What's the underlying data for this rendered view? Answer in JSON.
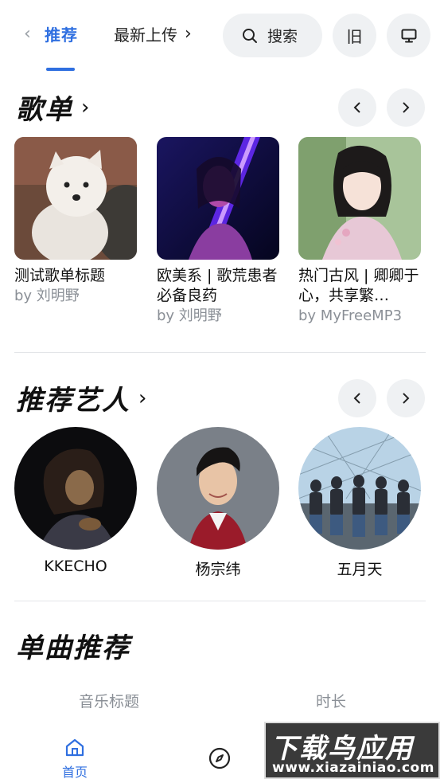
{
  "header": {
    "tabs": [
      {
        "label": "推荐",
        "active": true
      },
      {
        "label": "最新上传",
        "active": false
      }
    ],
    "search_label": "搜索",
    "old_label": "旧"
  },
  "playlists": {
    "title": "歌单",
    "items": [
      {
        "title": "测试歌单标题",
        "by": "by 刘明野"
      },
      {
        "title": "欧美系 | 歌荒患者必备良药",
        "by": "by 刘明野"
      },
      {
        "title": "热门古风 | 卿卿于心，共享繁…",
        "by": "by MyFreeMP3"
      }
    ]
  },
  "artists": {
    "title": "推荐艺人",
    "items": [
      {
        "name": "KKECHO"
      },
      {
        "name": "杨宗纬"
      },
      {
        "name": "五月天"
      }
    ]
  },
  "singles": {
    "title": "单曲推荐",
    "columns": [
      "音乐标题",
      "时长"
    ]
  },
  "bottom_nav": {
    "home_label": "首页"
  },
  "watermark": {
    "top": "下载鸟应用",
    "bottom": "www.xiazainiao.com"
  },
  "colors": {
    "accent": "#2f6fe0",
    "muted": "#8a8f96",
    "button_bg": "#eff1f3"
  }
}
